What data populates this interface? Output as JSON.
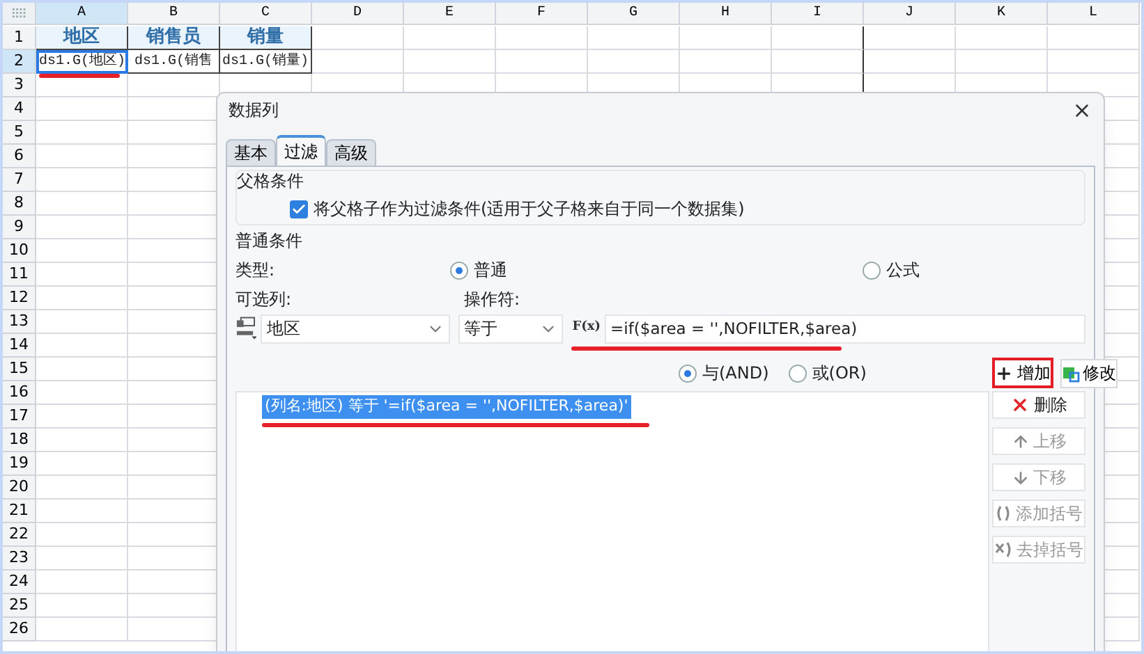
{
  "sheet": {
    "columns": [
      {
        "label": "A",
        "selected": true
      },
      {
        "label": "B",
        "selected": false
      },
      {
        "label": "C",
        "selected": false
      },
      {
        "label": "D",
        "selected": false
      },
      {
        "label": "E",
        "selected": false
      },
      {
        "label": "F",
        "selected": false
      },
      {
        "label": "G",
        "selected": false
      },
      {
        "label": "H",
        "selected": false
      },
      {
        "label": "I",
        "selected": false
      },
      {
        "label": "J",
        "selected": false
      },
      {
        "label": "K",
        "selected": false
      },
      {
        "label": "L",
        "selected": false
      }
    ],
    "rows": [
      {
        "label": "1",
        "selected": false,
        "cells": [
          {
            "text": "地区",
            "kind": "header",
            "selected": false
          },
          {
            "text": "销售员",
            "kind": "header",
            "selected": false
          },
          {
            "text": "销量",
            "kind": "header",
            "selected": false
          }
        ]
      },
      {
        "label": "2",
        "selected": true,
        "cells": [
          {
            "text": "ds1.G(地区)",
            "kind": "formula",
            "selected": true,
            "annotated": true
          },
          {
            "text": "ds1.G(销售",
            "kind": "formula",
            "selected": false,
            "annotated": false
          },
          {
            "text": "ds1.G(销量)",
            "kind": "formula",
            "selected": false,
            "annotated": false
          }
        ]
      },
      {
        "label": "3",
        "selected": false
      },
      {
        "label": "4",
        "selected": false
      },
      {
        "label": "5",
        "selected": false
      },
      {
        "label": "6",
        "selected": false
      },
      {
        "label": "7",
        "selected": false
      },
      {
        "label": "8",
        "selected": false
      },
      {
        "label": "9",
        "selected": false
      },
      {
        "label": "10",
        "selected": false
      },
      {
        "label": "11",
        "selected": false
      },
      {
        "label": "12",
        "selected": false
      },
      {
        "label": "13",
        "selected": false
      },
      {
        "label": "14",
        "selected": false
      },
      {
        "label": "15",
        "selected": false
      },
      {
        "label": "16",
        "selected": false
      },
      {
        "label": "17",
        "selected": false
      },
      {
        "label": "18",
        "selected": false
      },
      {
        "label": "19",
        "selected": false
      },
      {
        "label": "20",
        "selected": false
      },
      {
        "label": "21",
        "selected": false
      },
      {
        "label": "22",
        "selected": false
      },
      {
        "label": "23",
        "selected": false
      },
      {
        "label": "24",
        "selected": false
      },
      {
        "label": "25",
        "selected": false
      },
      {
        "label": "26",
        "selected": false
      }
    ]
  },
  "dialog": {
    "title": "数据列",
    "tabs": [
      {
        "label": "基本",
        "selected": false
      },
      {
        "label": "过滤",
        "selected": true
      },
      {
        "label": "高级",
        "selected": false
      }
    ],
    "parent_condition": {
      "title": "父格条件",
      "checkbox": {
        "label": "将父格子作为过滤条件(适用于父子格来自于同一个数据集)",
        "checked": true
      }
    },
    "normal_condition": {
      "title": "普通条件",
      "type_label": "类型:",
      "type_options": [
        {
          "label": "普通",
          "selected": true
        },
        {
          "label": "公式",
          "selected": false
        }
      ],
      "column_label": "可选列:",
      "operator_label": "操作符:",
      "column_value": "地区",
      "operator_value": "等于",
      "formula_button": "F(x)",
      "formula_value": "=if($area = '',NOFILTER,$area)"
    },
    "logic_options": [
      {
        "label": "与(AND)",
        "selected": true
      },
      {
        "label": "或(OR)",
        "selected": false
      }
    ],
    "add_button": "增加",
    "modify_button": "修改",
    "conditions": [
      {
        "text": "(列名:地区) 等于 '=if($area = '',NOFILTER,$area)'",
        "selected": true
      }
    ],
    "side_buttons": [
      {
        "label": "删除",
        "kind": "delete",
        "disabled": false
      },
      {
        "label": "上移",
        "kind": "up",
        "disabled": true
      },
      {
        "label": "下移",
        "kind": "down",
        "disabled": true
      },
      {
        "label": "添加括号",
        "kind": "add-brackets",
        "disabled": true
      },
      {
        "label": "去掉括号",
        "kind": "remove-brackets",
        "disabled": true
      }
    ]
  }
}
